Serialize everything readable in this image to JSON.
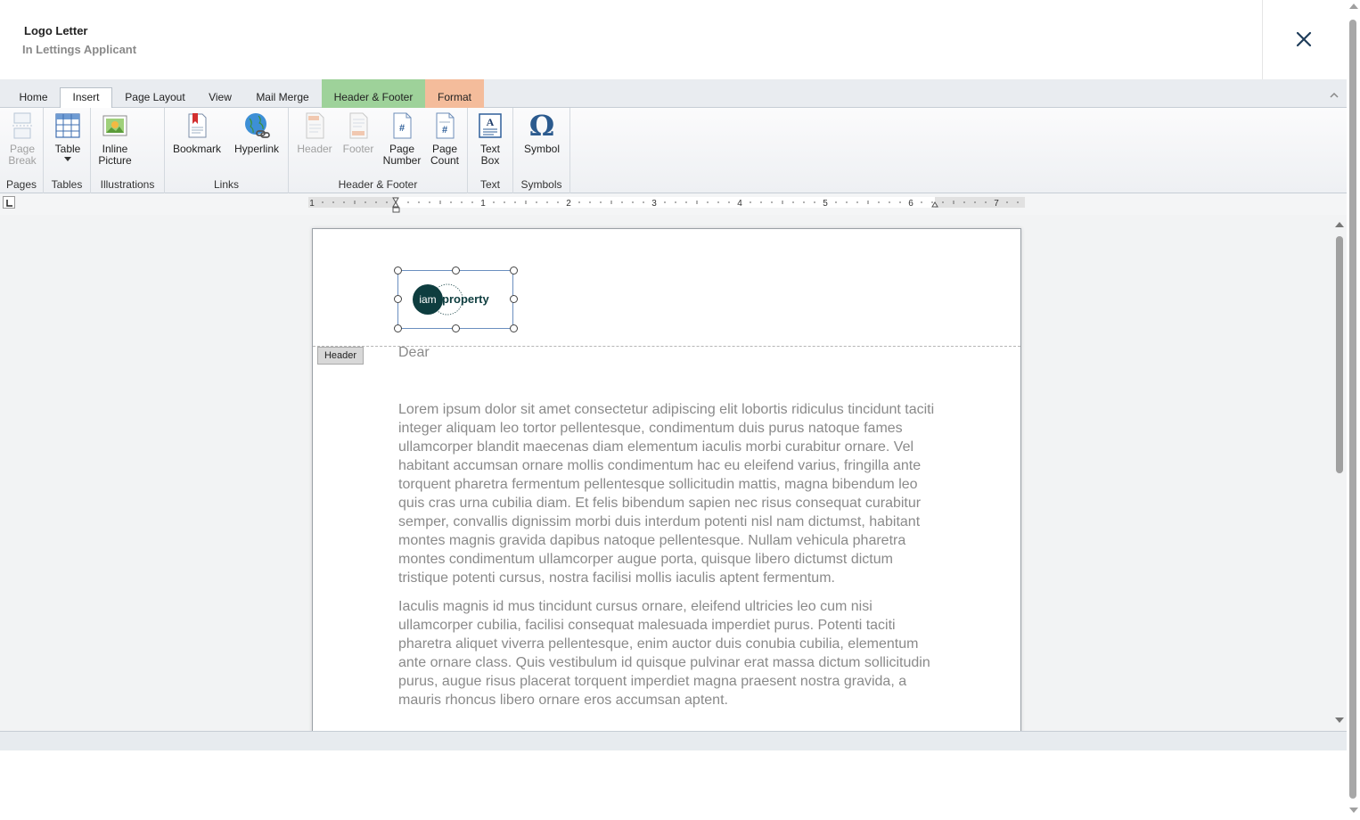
{
  "window": {
    "title": "Logo Letter",
    "subtitle": "In Lettings Applicant"
  },
  "tabs": [
    {
      "label": "Home",
      "active": false
    },
    {
      "label": "Insert",
      "active": true
    },
    {
      "label": "Page Layout",
      "active": false
    },
    {
      "label": "View",
      "active": false
    },
    {
      "label": "Mail Merge",
      "active": false
    },
    {
      "label": "Header & Footer",
      "active": false,
      "color": "#9ed29a"
    },
    {
      "label": "Format",
      "active": false,
      "color": "#f4bc9b"
    }
  ],
  "ribbon": {
    "groups": {
      "pages": "Pages",
      "tables": "Tables",
      "illustrations": "Illustrations",
      "links": "Links",
      "header_footer": "Header & Footer",
      "text": "Text",
      "symbols": "Symbols"
    },
    "buttons": {
      "page_break": [
        "Page",
        "Break"
      ],
      "table": "Table",
      "inline_picture": [
        "Inline",
        "Picture"
      ],
      "bookmark": "Bookmark",
      "hyperlink": "Hyperlink",
      "header": "Header",
      "footer": "Footer",
      "page_number": [
        "Page",
        "Number"
      ],
      "page_count": [
        "Page",
        "Count"
      ],
      "text_box": [
        "Text",
        "Box"
      ],
      "symbol": "Symbol"
    },
    "icons": {
      "page_break": "page-break-icon",
      "table": "table-icon",
      "inline_picture": "picture-icon",
      "bookmark": "bookmark-icon",
      "hyperlink": "globe-link-icon",
      "header": "header-icon",
      "footer": "footer-icon",
      "page_number": "page-number-icon",
      "page_count": "page-count-icon",
      "text_box": "text-box-icon",
      "symbol": "omega-icon"
    }
  },
  "ruler": {
    "labels": [
      "1",
      "1",
      "2",
      "3",
      "4",
      "5",
      "6",
      "7"
    ]
  },
  "document": {
    "header_tag": "Header",
    "logo": {
      "word_a": "iam",
      "word_b": "property",
      "color": "#0e3d3f"
    },
    "greeting": "Dear",
    "paragraphs": [
      "Lorem ipsum dolor sit amet consectetur adipiscing elit lobortis ridiculus tincidunt taciti integer aliquam leo tortor pellentesque, condimentum duis purus natoque fames ullamcorper blandit maecenas diam elementum iaculis morbi curabitur ornare. Vel habitant accumsan ornare mollis condimentum hac eu eleifend varius, fringilla ante torquent pharetra fermentum pellentesque sollicitudin mattis, magna bibendum leo quis cras urna cubilia diam. Et felis bibendum sapien nec risus consequat curabitur semper, convallis dignissim morbi duis interdum potenti nisl nam dictumst, habitant montes magnis gravida dapibus natoque pellentesque. Nullam vehicula pharetra montes condimentum ullamcorper augue porta, quisque libero dictumst dictum tristique potenti cursus, nostra facilisi mollis iaculis aptent fermentum.",
      "Iaculis magnis id mus tincidunt cursus ornare, eleifend ultricies leo cum nisi ullamcorper cubilia, facilisi consequat malesuada imperdiet purus. Potenti taciti pharetra aliquet viverra pellentesque, enim auctor duis conubia cubilia, elementum ante ornare class. Quis vestibulum id quisque pulvinar erat massa dictum sollicitudin purus, augue risus placerat torquent imperdiet magna praesent nostra gravida, a mauris rhoncus libero ornare eros accumsan aptent."
    ]
  }
}
